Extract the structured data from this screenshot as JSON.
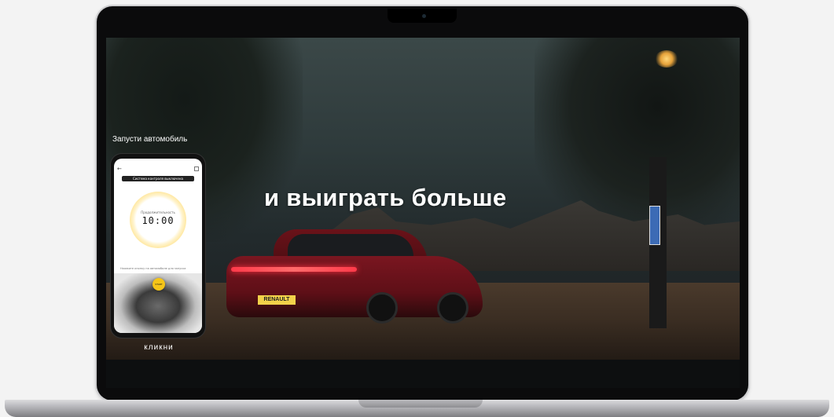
{
  "video": {
    "headline": "и выиграть больше",
    "caption_top": "Запусти автомобиль",
    "caption_bottom": "кликни",
    "car_plate": "RENAULT"
  },
  "phone": {
    "back_icon": "arrow-left-icon",
    "menu_icon": "menu-icon",
    "status_strip": "Система контроля выключена",
    "timer_label": "Продолжительность",
    "timer_value": "10:00",
    "note": "Нажмите кнопку на автомобиле для запуска",
    "button_label": "START"
  },
  "colors": {
    "accent_yellow": "#f5c518",
    "tail_light_red": "#ff3a4a",
    "car_red": "#7a1620"
  }
}
